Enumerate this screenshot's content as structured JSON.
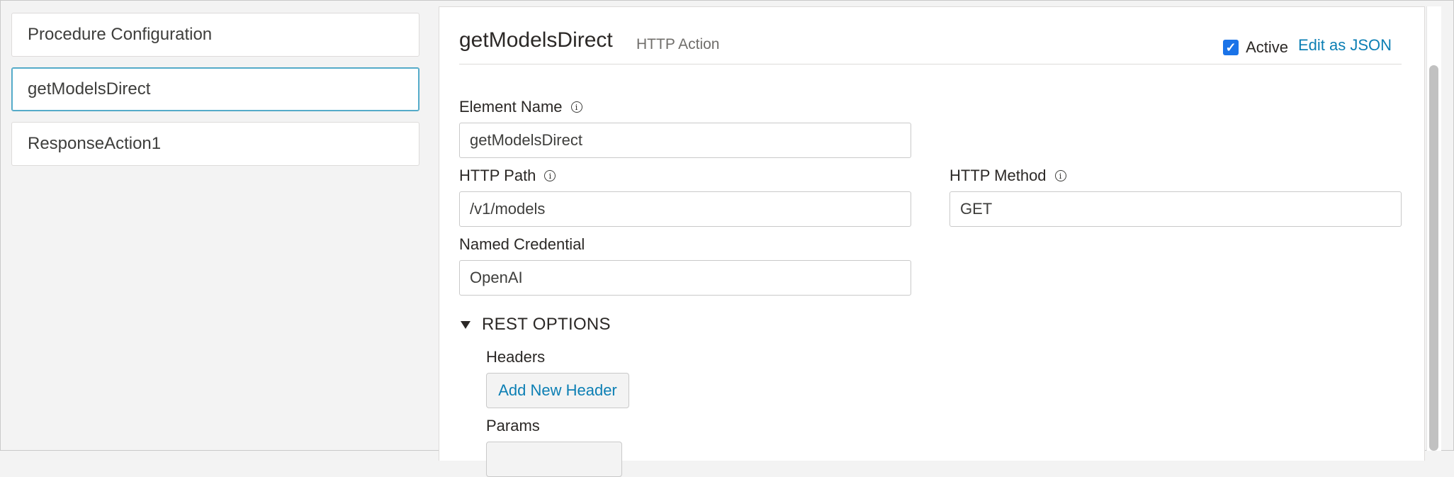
{
  "sidebar": {
    "items": [
      {
        "label": "Procedure Configuration"
      },
      {
        "label": "getModelsDirect"
      },
      {
        "label": "ResponseAction1"
      }
    ]
  },
  "header": {
    "title": "getModelsDirect",
    "subtitle": "HTTP Action",
    "active_label": "Active",
    "active_checked": true,
    "edit_json_label": "Edit as JSON"
  },
  "form": {
    "element_name": {
      "label": "Element Name",
      "value": "getModelsDirect"
    },
    "http_path": {
      "label": "HTTP Path",
      "value": "/v1/models"
    },
    "http_method": {
      "label": "HTTP Method",
      "value": "GET"
    },
    "named_credential": {
      "label": "Named Credential",
      "value": "OpenAI"
    }
  },
  "rest_options": {
    "label": "REST OPTIONS",
    "headers_label": "Headers",
    "add_header_label": "Add New Header",
    "params_label": "Params"
  },
  "icons": {
    "info": "info-icon",
    "check": "checkbox-checked-icon",
    "expand": "triangle-down-icon"
  }
}
